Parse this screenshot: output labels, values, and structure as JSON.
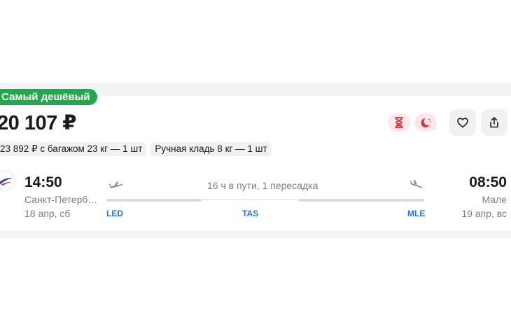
{
  "offer": {
    "badge": "Самый дешёвый",
    "price": "20 107 ₽",
    "baggage_chip": "23 892 ₽ с багажом 23 кг — 1 шт",
    "hand_luggage_chip": "Ручная кладь 8 кг — 1 шт"
  },
  "flight": {
    "departure": {
      "time": "14:50",
      "city": "Санкт-Петерб…",
      "date": "18 апр, сб",
      "code": "LED"
    },
    "arrival": {
      "time": "08:50",
      "city": "Мале",
      "date": "19 апр, вс",
      "code": "MLE"
    },
    "duration": "16 ч в пути, 1 пересадка",
    "layover_code": "TAS"
  },
  "colors": {
    "badge": "#22a94b",
    "accent_code": "#1e78d8",
    "tag_bg": "#fde7ea",
    "tag_icon": "#d6313d"
  },
  "icons": {
    "tag_1": "hourglass-icon",
    "tag_2": "moon-icon",
    "favorite": "heart-icon",
    "share": "share-icon",
    "airline": "airline-logo",
    "takeoff": "takeoff-plane-icon",
    "landing": "landing-plane-icon"
  }
}
